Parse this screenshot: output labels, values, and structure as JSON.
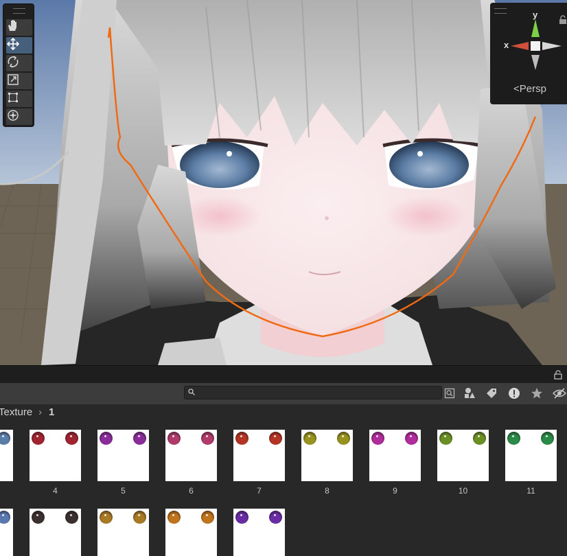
{
  "scene": {
    "tools": [
      {
        "name": "hand-tool",
        "icon": "hand-icon",
        "active": false
      },
      {
        "name": "move-tool",
        "icon": "move-arrows-icon",
        "active": true
      },
      {
        "name": "rotate-tool",
        "icon": "rotate-icon",
        "active": false
      },
      {
        "name": "scale-tool",
        "icon": "scale-icon",
        "active": false
      },
      {
        "name": "rect-tool",
        "icon": "rect-transform-icon",
        "active": false
      },
      {
        "name": "transform-tool",
        "icon": "transform-icon",
        "active": false
      }
    ],
    "gizmo": {
      "y_label": "y",
      "x_label": "x",
      "persp_label": "Persp",
      "colors": {
        "x": "#d0503c",
        "y": "#7cd048",
        "z": "#d8d8d8"
      }
    },
    "outline_color": "#f06a14"
  },
  "project": {
    "search": {
      "value": "",
      "placeholder": ""
    },
    "toolbar_icons": [
      "filter-by-type-icon",
      "filter-by-label-icon",
      "warning-icon",
      "favorite-star-icon",
      "hidden-eye-icon"
    ],
    "breadcrumb": {
      "parent": "Texture",
      "separator": "›",
      "current": "1"
    },
    "textures_row1": [
      {
        "label": "",
        "color": "#5b7ea8"
      },
      {
        "label": "4",
        "color": "#a02430"
      },
      {
        "label": "5",
        "color": "#8a2c9a"
      },
      {
        "label": "6",
        "color": "#b03a6a"
      },
      {
        "label": "7",
        "color": "#b43424"
      },
      {
        "label": "8",
        "color": "#98921e"
      },
      {
        "label": "9",
        "color": "#b02c9c"
      },
      {
        "label": "10",
        "color": "#6a9024"
      },
      {
        "label": "11",
        "color": "#2a8a48"
      }
    ],
    "textures_row2": [
      {
        "label": "",
        "color": "#5a78b0"
      },
      {
        "label": "",
        "color": "#3a3030"
      },
      {
        "label": "",
        "color": "#a87a24"
      },
      {
        "label": "",
        "color": "#c0741c"
      },
      {
        "label": "",
        "color": "#6a2ca4"
      }
    ]
  }
}
